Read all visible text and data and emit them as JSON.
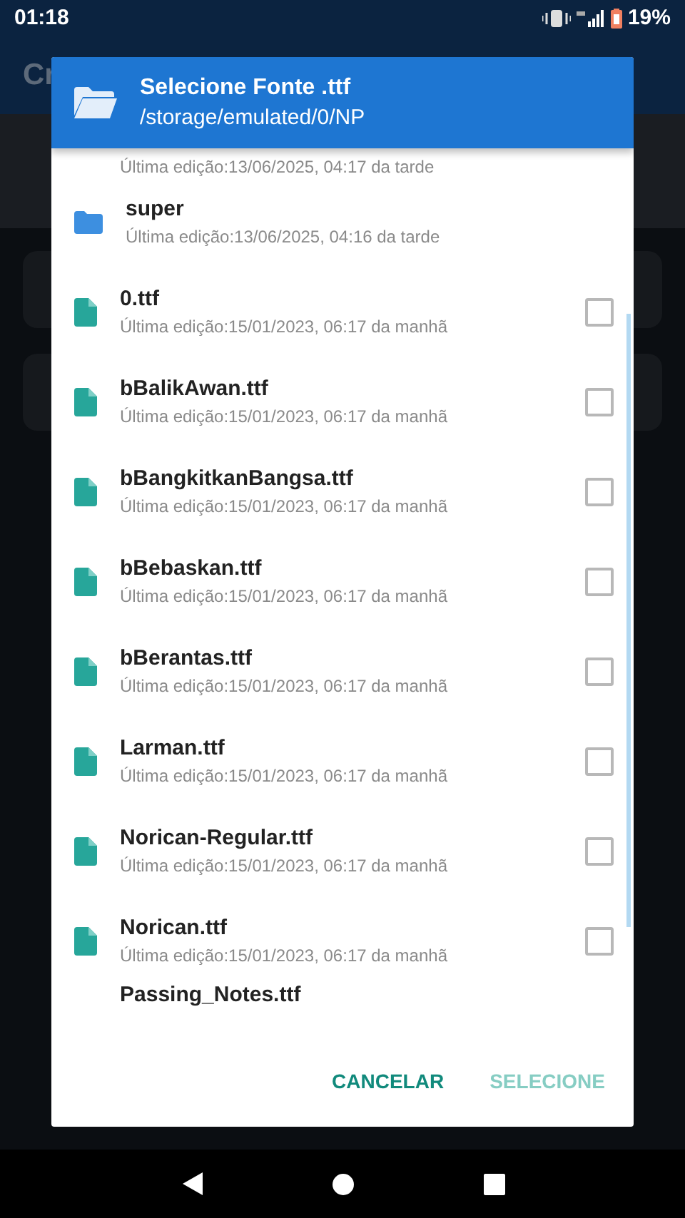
{
  "status_bar": {
    "time": "01:18",
    "battery": "19%"
  },
  "app": {
    "title": "Cr"
  },
  "dialog": {
    "title": "Selecione Fonte .ttf",
    "path": "/storage/emulated/0/NP",
    "cut_top_meta": "Última edição:13/06/2025, 04:17 da tarde",
    "items": [
      {
        "kind": "folder",
        "name": "super",
        "meta": "Última edição:13/06/2025, 04:16 da tarde"
      },
      {
        "kind": "file",
        "name": "0.ttf",
        "meta": "Última edição:15/01/2023, 06:17 da manhã",
        "checked": false
      },
      {
        "kind": "file",
        "name": "bBalikAwan.ttf",
        "meta": "Última edição:15/01/2023, 06:17 da manhã",
        "checked": false
      },
      {
        "kind": "file",
        "name": "bBangkitkanBangsa.ttf",
        "meta": "Última edição:15/01/2023, 06:17 da manhã",
        "checked": false
      },
      {
        "kind": "file",
        "name": "bBebaskan.ttf",
        "meta": "Última edição:15/01/2023, 06:17 da manhã",
        "checked": false
      },
      {
        "kind": "file",
        "name": "bBerantas.ttf",
        "meta": "Última edição:15/01/2023, 06:17 da manhã",
        "checked": false
      },
      {
        "kind": "file",
        "name": "Larman.ttf",
        "meta": "Última edição:15/01/2023, 06:17 da manhã",
        "checked": false
      },
      {
        "kind": "file",
        "name": "Norican-Regular.ttf",
        "meta": "Última edição:15/01/2023, 06:17 da manhã",
        "checked": false
      },
      {
        "kind": "file",
        "name": "Norican.ttf",
        "meta": "Última edição:15/01/2023, 06:17 da manhã",
        "checked": false
      }
    ],
    "cut_bottom_name": "Passing_Notes.ttf",
    "buttons": [
      {
        "label": "CANCELAR",
        "disabled": false
      },
      {
        "label": "SELECIONE",
        "disabled": true
      }
    ]
  }
}
